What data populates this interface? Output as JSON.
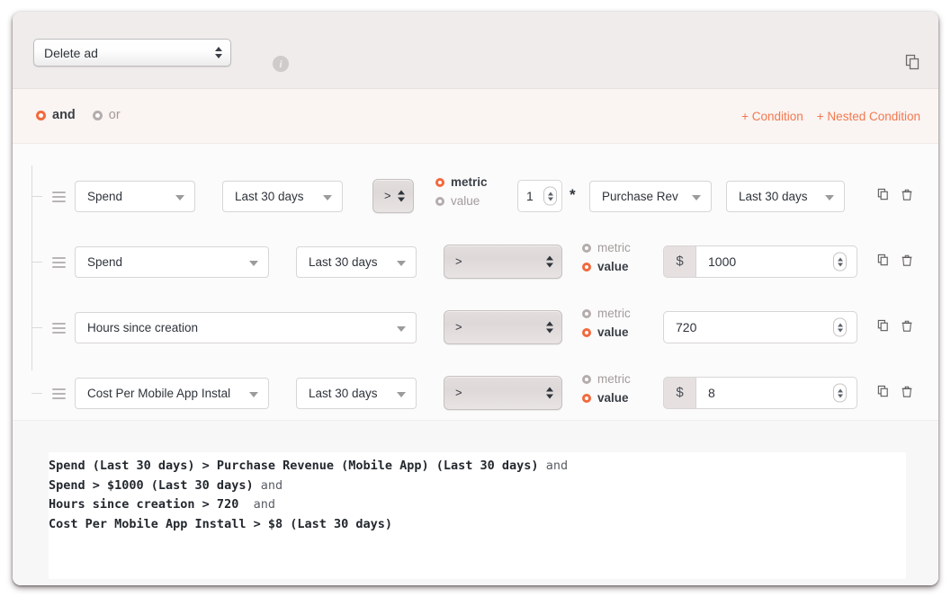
{
  "header": {
    "action_select_value": "Delete ad",
    "info_icon": "info-icon",
    "copy_icon": "copy-icon"
  },
  "logic": {
    "options": [
      {
        "label": "and",
        "selected": true
      },
      {
        "label": "or",
        "selected": false
      }
    ],
    "add_condition_label": "+ Condition",
    "add_nested_condition_label": "+ Nested Condition"
  },
  "colors": {
    "accent": "#f2693c",
    "link": "#f2794e",
    "header_bg": "#f0ecec",
    "logic_bg": "#faf4f3",
    "conditions_bg": "#fbfbfb",
    "summary_bg": "#f7f7f7"
  },
  "conditions": [
    {
      "metric": "Spend",
      "metric_range": "Last 30 days",
      "operator": ">",
      "compare_mode": "metric",
      "metric_radio_label": "metric",
      "value_radio_label": "value",
      "multiplier": "1",
      "multiply_symbol": "*",
      "compare_metric": "Purchase Rev",
      "compare_range": "Last 30 days",
      "copy_icon": "copy-icon",
      "delete_icon": "trash-icon"
    },
    {
      "metric": "Spend",
      "metric_range": "Last 30 days",
      "operator": ">",
      "compare_mode": "value",
      "metric_radio_label": "metric",
      "value_radio_label": "value",
      "currency_prefix": "$",
      "value": "1000",
      "copy_icon": "copy-icon",
      "delete_icon": "trash-icon"
    },
    {
      "metric": "Hours since creation",
      "metric_range": null,
      "operator": ">",
      "compare_mode": "value",
      "metric_radio_label": "metric",
      "value_radio_label": "value",
      "currency_prefix": null,
      "value": "720",
      "copy_icon": "copy-icon",
      "delete_icon": "trash-icon"
    },
    {
      "metric": "Cost Per Mobile App Instal",
      "metric_range": "Last 30 days",
      "operator": ">",
      "compare_mode": "value",
      "metric_radio_label": "metric",
      "value_radio_label": "value",
      "currency_prefix": "$",
      "value": "8",
      "copy_icon": "copy-icon",
      "delete_icon": "trash-icon"
    }
  ],
  "summary": {
    "lines": [
      {
        "expr": "Spend (Last 30 days) > Purchase Revenue (Mobile App) (Last 30 days)",
        "conj": " and"
      },
      {
        "expr": "Spend > $1000 (Last 30 days)",
        "conj": " and"
      },
      {
        "expr": "Hours since creation > 720",
        "conj": "  and"
      },
      {
        "expr": "Cost Per Mobile App Install > $8 (Last 30 days)",
        "conj": ""
      }
    ]
  }
}
